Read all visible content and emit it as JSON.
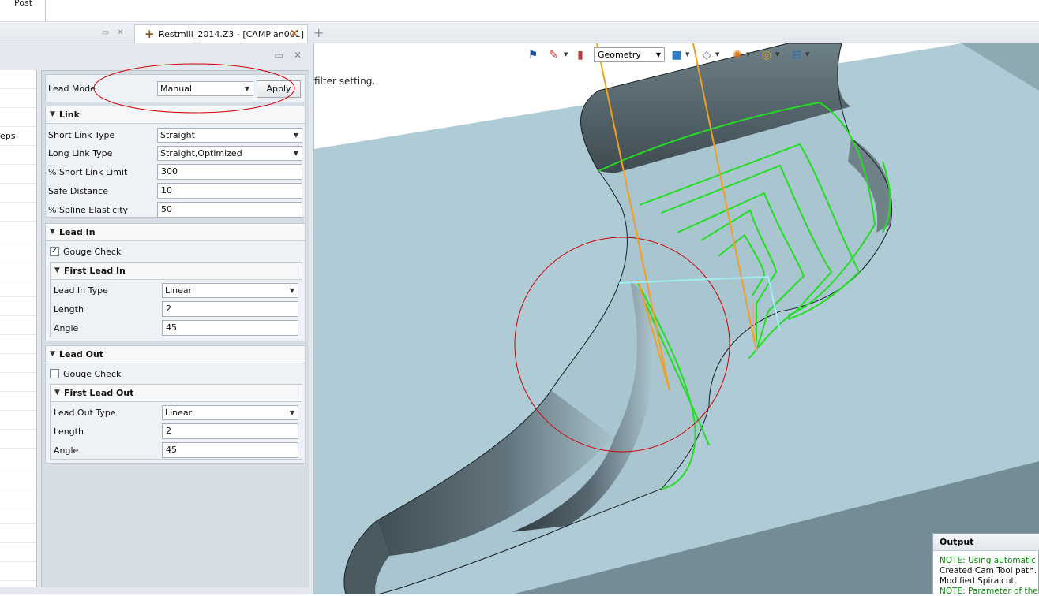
{
  "ribbon": {
    "post_label": "Post"
  },
  "doc_tab": {
    "title": "Restmill_2014.Z3 - [CAMPlan001]"
  },
  "nav_partial": {
    "row3": "eps"
  },
  "lead_mode": {
    "label": "Lead Mode",
    "value": "Manual",
    "apply_label": "Apply"
  },
  "link": {
    "title": "Link",
    "short_link_type_label": "Short Link Type",
    "short_link_type_value": "Straight",
    "long_link_type_label": "Long Link Type",
    "long_link_type_value": "Straight,Optimized",
    "short_link_limit_label": "% Short Link Limit",
    "short_link_limit_value": "300",
    "safe_distance_label": "Safe Distance",
    "safe_distance_value": "10",
    "spline_elasticity_label": "% Spline Elasticity",
    "spline_elasticity_value": "50"
  },
  "lead_in": {
    "title": "Lead In",
    "gouge_label": "Gouge Check",
    "gouge_checked": true,
    "first_title": "First Lead In",
    "type_label": "Lead In Type",
    "type_value": "Linear",
    "length_label": "Length",
    "length_value": "2",
    "angle_label": "Angle",
    "angle_value": "45"
  },
  "lead_out": {
    "title": "Lead Out",
    "gouge_label": "Gouge Check",
    "gouge_checked": false,
    "first_title": "First Lead Out",
    "type_label": "Lead Out Type",
    "type_value": "Linear",
    "length_label": "Length",
    "length_value": "2",
    "angle_label": "Angle",
    "angle_value": "45"
  },
  "viewport": {
    "filter_text": "filter setting.",
    "view_mode": "Geometry"
  },
  "output": {
    "title": "Output",
    "lines": [
      {
        "text": "NOTE: Using automatic en",
        "color": "#0a8a0a"
      },
      {
        "text": "Created Cam Tool path.",
        "color": "#111111"
      },
      {
        "text": "Modified Spiralcut.",
        "color": "#111111"
      },
      {
        "text": "NOTE: Parameter of the c",
        "color": "#0a8a0a"
      }
    ]
  },
  "colors": {
    "part_face": "#aecbd6",
    "wall_dark": "#3f4b52",
    "toolpath": "#22dd22",
    "tool_axis": "#f0a020",
    "annotation": "#d00000"
  }
}
